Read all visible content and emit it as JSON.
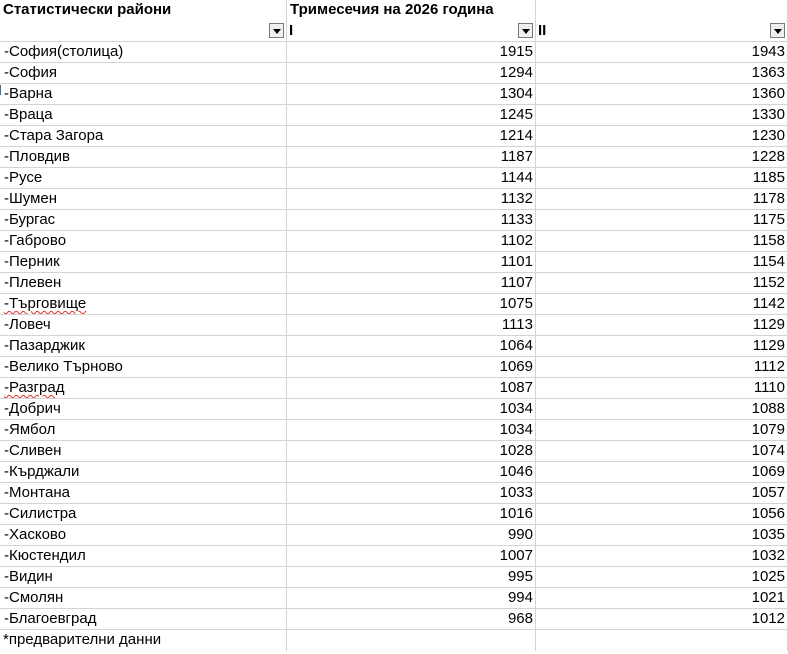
{
  "header": {
    "col1": "Статистически райони",
    "col2": "Тримесечия на 2026 година",
    "col3": ""
  },
  "filters": {
    "q1": "I",
    "q2": "II"
  },
  "rows": [
    {
      "region": "-София(столица)",
      "q1": "1915",
      "q2": "1943"
    },
    {
      "region": "-София",
      "q1": "1294",
      "q2": "1363"
    },
    {
      "region": "-Варна",
      "q1": "1304",
      "q2": "1360"
    },
    {
      "region": "-Враца",
      "q1": "1245",
      "q2": "1330"
    },
    {
      "region": "-Стара Загора",
      "q1": "1214",
      "q2": "1230"
    },
    {
      "region": "-Пловдив",
      "q1": "1187",
      "q2": "1228"
    },
    {
      "region": "-Русе",
      "q1": "1144",
      "q2": "1185"
    },
    {
      "region": "-Шумен",
      "q1": "1132",
      "q2": "1178"
    },
    {
      "region": "-Бургас",
      "q1": "1133",
      "q2": "1175"
    },
    {
      "region": "-Габрово",
      "q1": "1102",
      "q2": "1158"
    },
    {
      "region": "-Перник",
      "q1": "1101",
      "q2": "1154"
    },
    {
      "region": "-Плевен",
      "q1": "1107",
      "q2": "1152"
    },
    {
      "region": "-Търговище",
      "q1": "1075",
      "q2": "1142"
    },
    {
      "region": "-Ловеч",
      "q1": "1113",
      "q2": "1129"
    },
    {
      "region": "-Пазарджик",
      "q1": "1064",
      "q2": "1129"
    },
    {
      "region": "-Велико Търново",
      "q1": "1069",
      "q2": "1112"
    },
    {
      "region": "-Разград",
      "q1": "1087",
      "q2": "1110"
    },
    {
      "region": "-Добрич",
      "q1": "1034",
      "q2": "1088"
    },
    {
      "region": "-Ямбол",
      "q1": "1034",
      "q2": "1079"
    },
    {
      "region": "-Сливен",
      "q1": "1028",
      "q2": "1074"
    },
    {
      "region": "-Кърджали",
      "q1": "1046",
      "q2": "1069"
    },
    {
      "region": "-Монтана",
      "q1": "1033",
      "q2": "1057"
    },
    {
      "region": "-Силистра",
      "q1": "1016",
      "q2": "1056"
    },
    {
      "region": "-Хасково",
      "q1": "990",
      "q2": "1035"
    },
    {
      "region": "-Кюстендил",
      "q1": "1007",
      "q2": "1032"
    },
    {
      "region": "-Видин",
      "q1": "995",
      "q2": "1025"
    },
    {
      "region": "-Смолян",
      "q1": "994",
      "q2": "1021"
    },
    {
      "region": "-Благоевград",
      "q1": "968",
      "q2": "1012"
    }
  ],
  "footnote": "*предварителни данни",
  "icons": {
    "filter": "dropdown-arrow-icon"
  }
}
